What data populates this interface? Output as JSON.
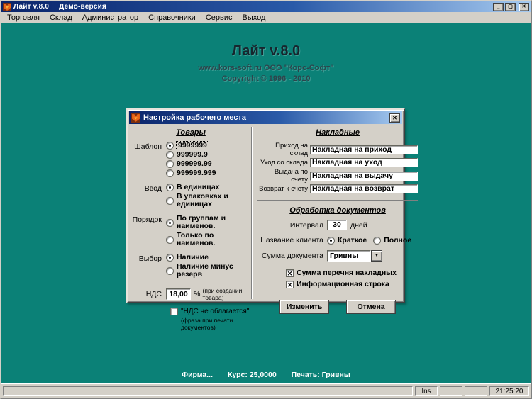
{
  "window": {
    "title": "Лайт v.8.0",
    "edition": "Демо-версия"
  },
  "icons": {
    "minimize": "_",
    "maximize": "▢",
    "close": "✕",
    "dropdown": "▼",
    "check": "✕"
  },
  "menu": [
    "Торговля",
    "Склад",
    "Администратор",
    "Справочники",
    "Сервис",
    "Выход"
  ],
  "branding": {
    "title": "Лайт v.8.0",
    "line1": "www.kors-soft.ru  ООО \"Корс-Софт\"",
    "line2": "Copyright © 1996 - 2010"
  },
  "dialog": {
    "title": "Настройка рабочего места",
    "tovary": {
      "heading": "Товары",
      "shablon": {
        "label": "Шаблон",
        "opts": [
          "9999999",
          "999999.9",
          "999999.99",
          "999999.999"
        ]
      },
      "vvod": {
        "label": "Ввод",
        "opts": [
          "В единицах",
          "В упаковках и единицах"
        ]
      },
      "poryadok": {
        "label": "Порядок",
        "opts": [
          "По группам и наименов.",
          "Только по наименов."
        ]
      },
      "vybor": {
        "label": "Выбор",
        "opts": [
          "Наличие",
          "Наличие минус резерв"
        ]
      },
      "nds": {
        "label": "НДС",
        "value": "18,00",
        "percent": "%",
        "note": "(при создании товара)",
        "checkbox": "\"НДС не облагается\"",
        "checkbox_note": "(фраза при печати документов)"
      }
    },
    "nakladnye": {
      "heading": "Накладные",
      "rows": [
        {
          "label": "Приход на склад",
          "value": "Накладная на приход"
        },
        {
          "label": "Уход со склада",
          "value": "Накладная на уход"
        },
        {
          "label": "Выдача по счету",
          "value": "Накладная на выдачу"
        },
        {
          "label": "Возврат к счету",
          "value": "Накладная на возврат"
        }
      ]
    },
    "obrabotka": {
      "heading": "Обработка документов",
      "interval": {
        "label": "Интервал",
        "value": "30",
        "suffix": "дней"
      },
      "client": {
        "label": "Название клиента",
        "opt1": "Краткое",
        "opt2": "Полное"
      },
      "summa": {
        "label": "Сумма документа",
        "value": "Гривны"
      },
      "check1": "Сумма перечня накладных",
      "check2": "Информационная строка"
    },
    "buttons": {
      "change": {
        "pre": "",
        "key": "И",
        "post": "зменить"
      },
      "cancel": {
        "pre": "От",
        "key": "м",
        "post": "ена"
      }
    }
  },
  "status_line": {
    "firm": "Фирма...",
    "rate": "Курс: 25,0000",
    "print": "Печать: Гривны"
  },
  "statusbar": {
    "ins": "Ins",
    "time": "21:25:20"
  }
}
